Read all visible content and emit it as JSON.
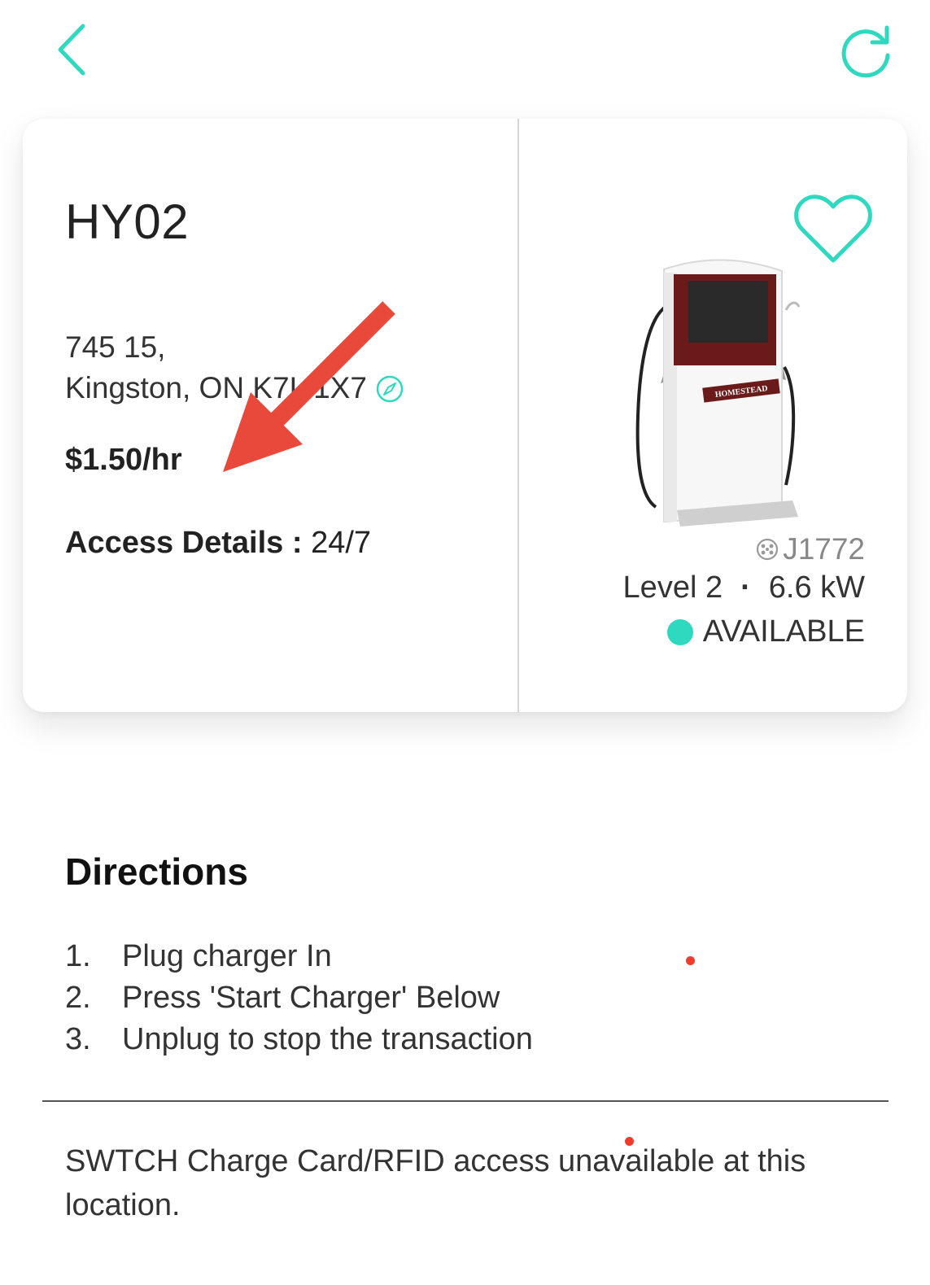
{
  "nav": {
    "back_icon": "chevron-left-icon",
    "refresh_icon": "refresh-icon"
  },
  "station": {
    "name": "HY02",
    "address_line1": "745 15,",
    "address_line2": "Kingston, ON K7L 1X7",
    "price": "$1.50/hr",
    "access_label": "Access Details :",
    "access_value": "24/7",
    "favorite_icon": "heart-outline-icon",
    "charger_brand": "HOMESTEAD",
    "connector": "J1772",
    "level": "Level 2",
    "power": "6.6 kW",
    "status": "AVAILABLE"
  },
  "directions": {
    "title": "Directions",
    "steps": [
      {
        "num": "1.",
        "text": "Plug charger In"
      },
      {
        "num": "2.",
        "text": "Press 'Start Charger' Below"
      },
      {
        "num": "3.",
        "text": "Unplug to stop the transaction"
      }
    ]
  },
  "notice": "SWTCH Charge Card/RFID access unavailable at this location.",
  "colors": {
    "accent": "#2fd9bf",
    "annotation_arrow": "#e8493b",
    "annotation_dot": "#f23b2b"
  }
}
